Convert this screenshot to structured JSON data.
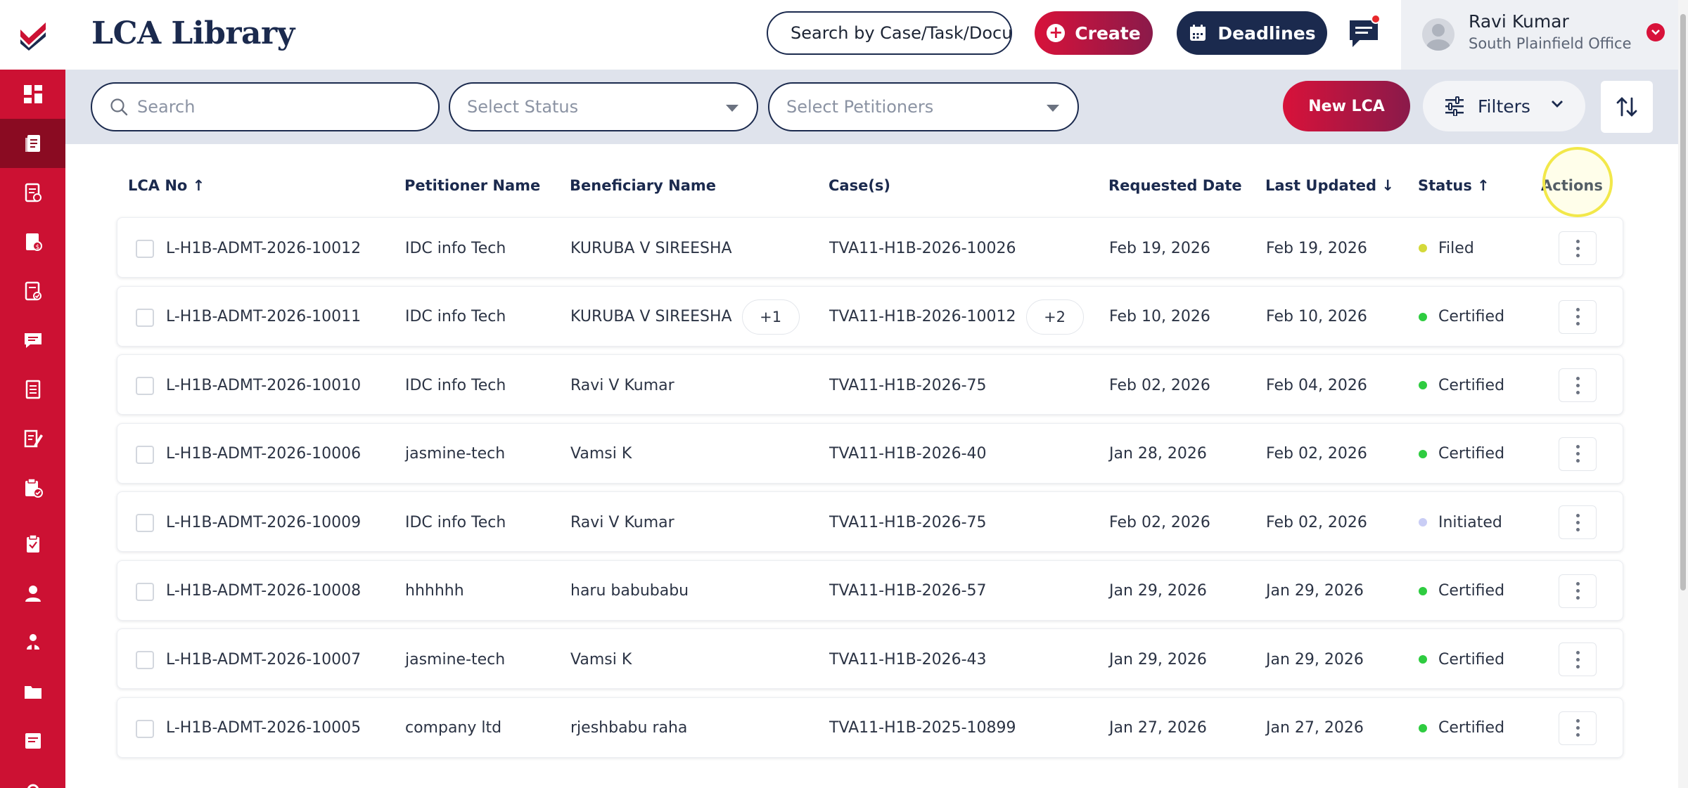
{
  "app": {
    "title": "LCA Library"
  },
  "header": {
    "global_search_text": "Search by Case/Task/Docu",
    "create_label": "Create",
    "deadlines_label": "Deadlines",
    "user_name": "Ravi Kumar",
    "user_office": "South Plainfield Office"
  },
  "filters": {
    "search_placeholder": "Search",
    "status_placeholder": "Select Status",
    "petitioners_placeholder": "Select Petitioners",
    "new_lca_label": "New LCA",
    "filters_label": "Filters"
  },
  "table": {
    "headers": {
      "lca_no": "LCA No ↑",
      "petitioner": "Petitioner Name",
      "beneficiary": "Beneficiary Name",
      "cases": "Case(s)",
      "requested": "Requested Date",
      "updated": "Last Updated ↓",
      "status": "Status ↑",
      "actions": "Actions"
    },
    "rows": [
      {
        "lca_no": "L-H1B-ADMT-2026-10012",
        "petitioner": "IDC info Tech",
        "beneficiary": "KURUBA V SIREESHA",
        "beneficiary_more": "",
        "cases": "TVA11-H1B-2026-10026",
        "cases_more": "",
        "requested": "Feb 19, 2026",
        "updated": "Feb 19, 2026",
        "status": "Filed"
      },
      {
        "lca_no": "L-H1B-ADMT-2026-10011",
        "petitioner": "IDC info Tech",
        "beneficiary": "KURUBA V SIREESHA",
        "beneficiary_more": "+1",
        "cases": "TVA11-H1B-2026-10012",
        "cases_more": "+2",
        "requested": "Feb 10, 2026",
        "updated": "Feb 10, 2026",
        "status": "Certified"
      },
      {
        "lca_no": "L-H1B-ADMT-2026-10010",
        "petitioner": "IDC info Tech",
        "beneficiary": "Ravi V Kumar",
        "beneficiary_more": "",
        "cases": "TVA11-H1B-2026-75",
        "cases_more": "",
        "requested": "Feb 02, 2026",
        "updated": "Feb 04, 2026",
        "status": "Certified"
      },
      {
        "lca_no": "L-H1B-ADMT-2026-10006",
        "petitioner": "jasmine-tech",
        "beneficiary": "Vamsi K",
        "beneficiary_more": "",
        "cases": "TVA11-H1B-2026-40",
        "cases_more": "",
        "requested": "Jan 28, 2026",
        "updated": "Feb 02, 2026",
        "status": "Certified"
      },
      {
        "lca_no": "L-H1B-ADMT-2026-10009",
        "petitioner": "IDC info Tech",
        "beneficiary": "Ravi V Kumar",
        "beneficiary_more": "",
        "cases": "TVA11-H1B-2026-75",
        "cases_more": "",
        "requested": "Feb 02, 2026",
        "updated": "Feb 02, 2026",
        "status": "Initiated"
      },
      {
        "lca_no": "L-H1B-ADMT-2026-10008",
        "petitioner": "hhhhhh",
        "beneficiary": "haru babubabu",
        "beneficiary_more": "",
        "cases": "TVA11-H1B-2026-57",
        "cases_more": "",
        "requested": "Jan 29, 2026",
        "updated": "Jan 29, 2026",
        "status": "Certified"
      },
      {
        "lca_no": "L-H1B-ADMT-2026-10007",
        "petitioner": "jasmine-tech",
        "beneficiary": "Vamsi K",
        "beneficiary_more": "",
        "cases": "TVA11-H1B-2026-43",
        "cases_more": "",
        "requested": "Jan 29, 2026",
        "updated": "Jan 29, 2026",
        "status": "Certified"
      },
      {
        "lca_no": "L-H1B-ADMT-2026-10005",
        "petitioner": "company ltd",
        "beneficiary": "rjeshbabu raha",
        "beneficiary_more": "",
        "cases": "TVA11-H1B-2025-10899",
        "cases_more": "",
        "requested": "Jan 27, 2026",
        "updated": "Jan 27, 2026",
        "status": "Certified"
      }
    ]
  },
  "colors": {
    "brand_red": "#cc1133",
    "navy": "#1b2a4e",
    "status_filed": "#d4d93a",
    "status_certified": "#2ecc40",
    "status_initiated": "#c9cdf5"
  },
  "sidebar": {
    "icons": [
      "dashboard-icon",
      "documents-icon",
      "forms-icon",
      "billing-icon",
      "checklist-icon",
      "messages-icon",
      "reports-icon",
      "edit-icon",
      "lca-icon",
      "tasks-icon",
      "user-icon",
      "people-icon",
      "folder-icon",
      "notes-icon"
    ]
  }
}
